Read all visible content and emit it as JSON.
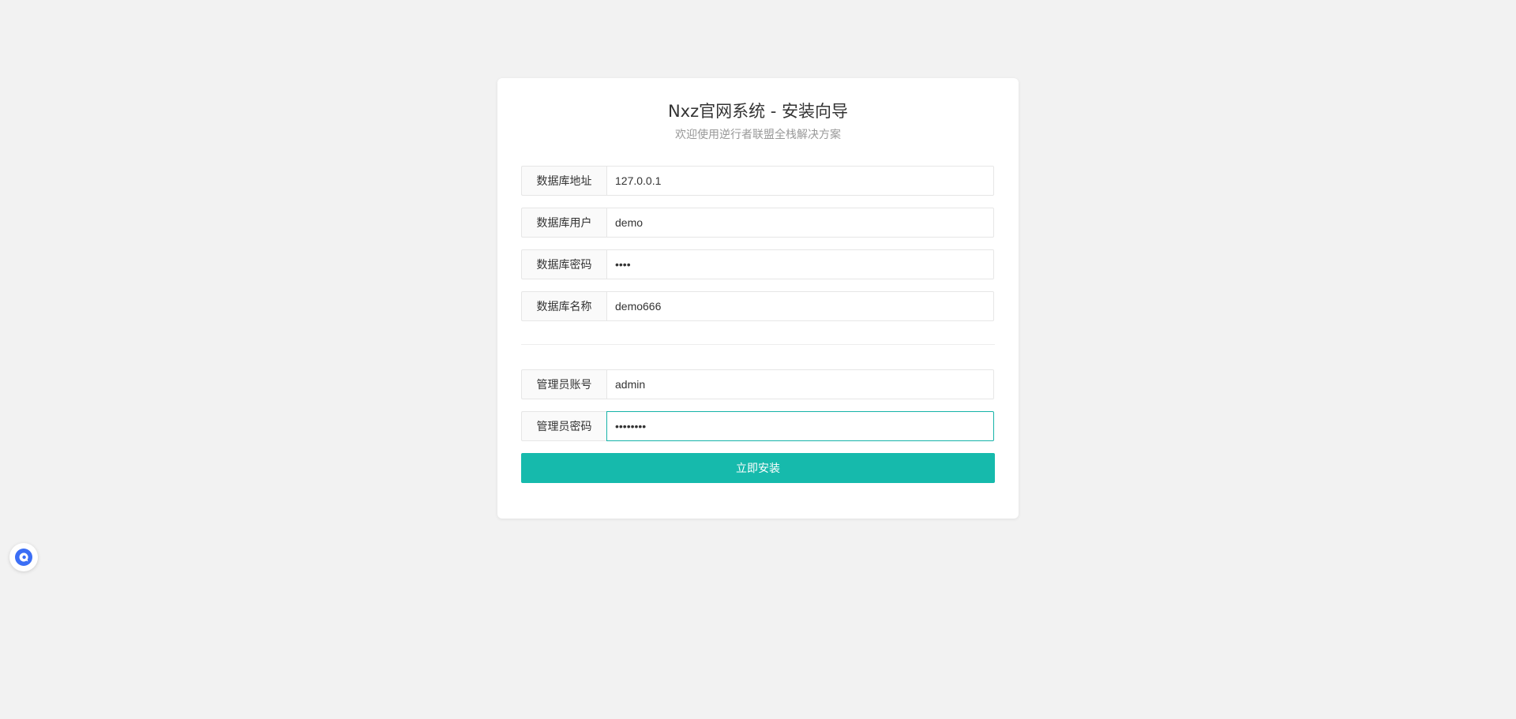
{
  "header": {
    "title": "Nxz官网系统 - 安装向导",
    "subtitle": "欢迎使用逆行者联盟全栈解决方案"
  },
  "database": {
    "fields": [
      {
        "label": "数据库地址",
        "value": "127.0.0.1",
        "type": "text"
      },
      {
        "label": "数据库用户",
        "value": "demo",
        "type": "text"
      },
      {
        "label": "数据库密码",
        "value": "demo",
        "type": "password"
      },
      {
        "label": "数据库名称",
        "value": "demo666",
        "type": "text"
      }
    ]
  },
  "admin": {
    "fields": [
      {
        "label": "管理员账号",
        "value": "admin",
        "type": "text"
      },
      {
        "label": "管理员密码",
        "value": "admin888",
        "type": "password"
      }
    ]
  },
  "actions": {
    "install_label": "立即安装"
  },
  "colors": {
    "accent": "#16baac",
    "focus_border": "#16b3a8",
    "background": "#f2f2f2",
    "widget": "#3b6ef5"
  },
  "widget": {
    "icon": "chat-bubble-icon"
  }
}
